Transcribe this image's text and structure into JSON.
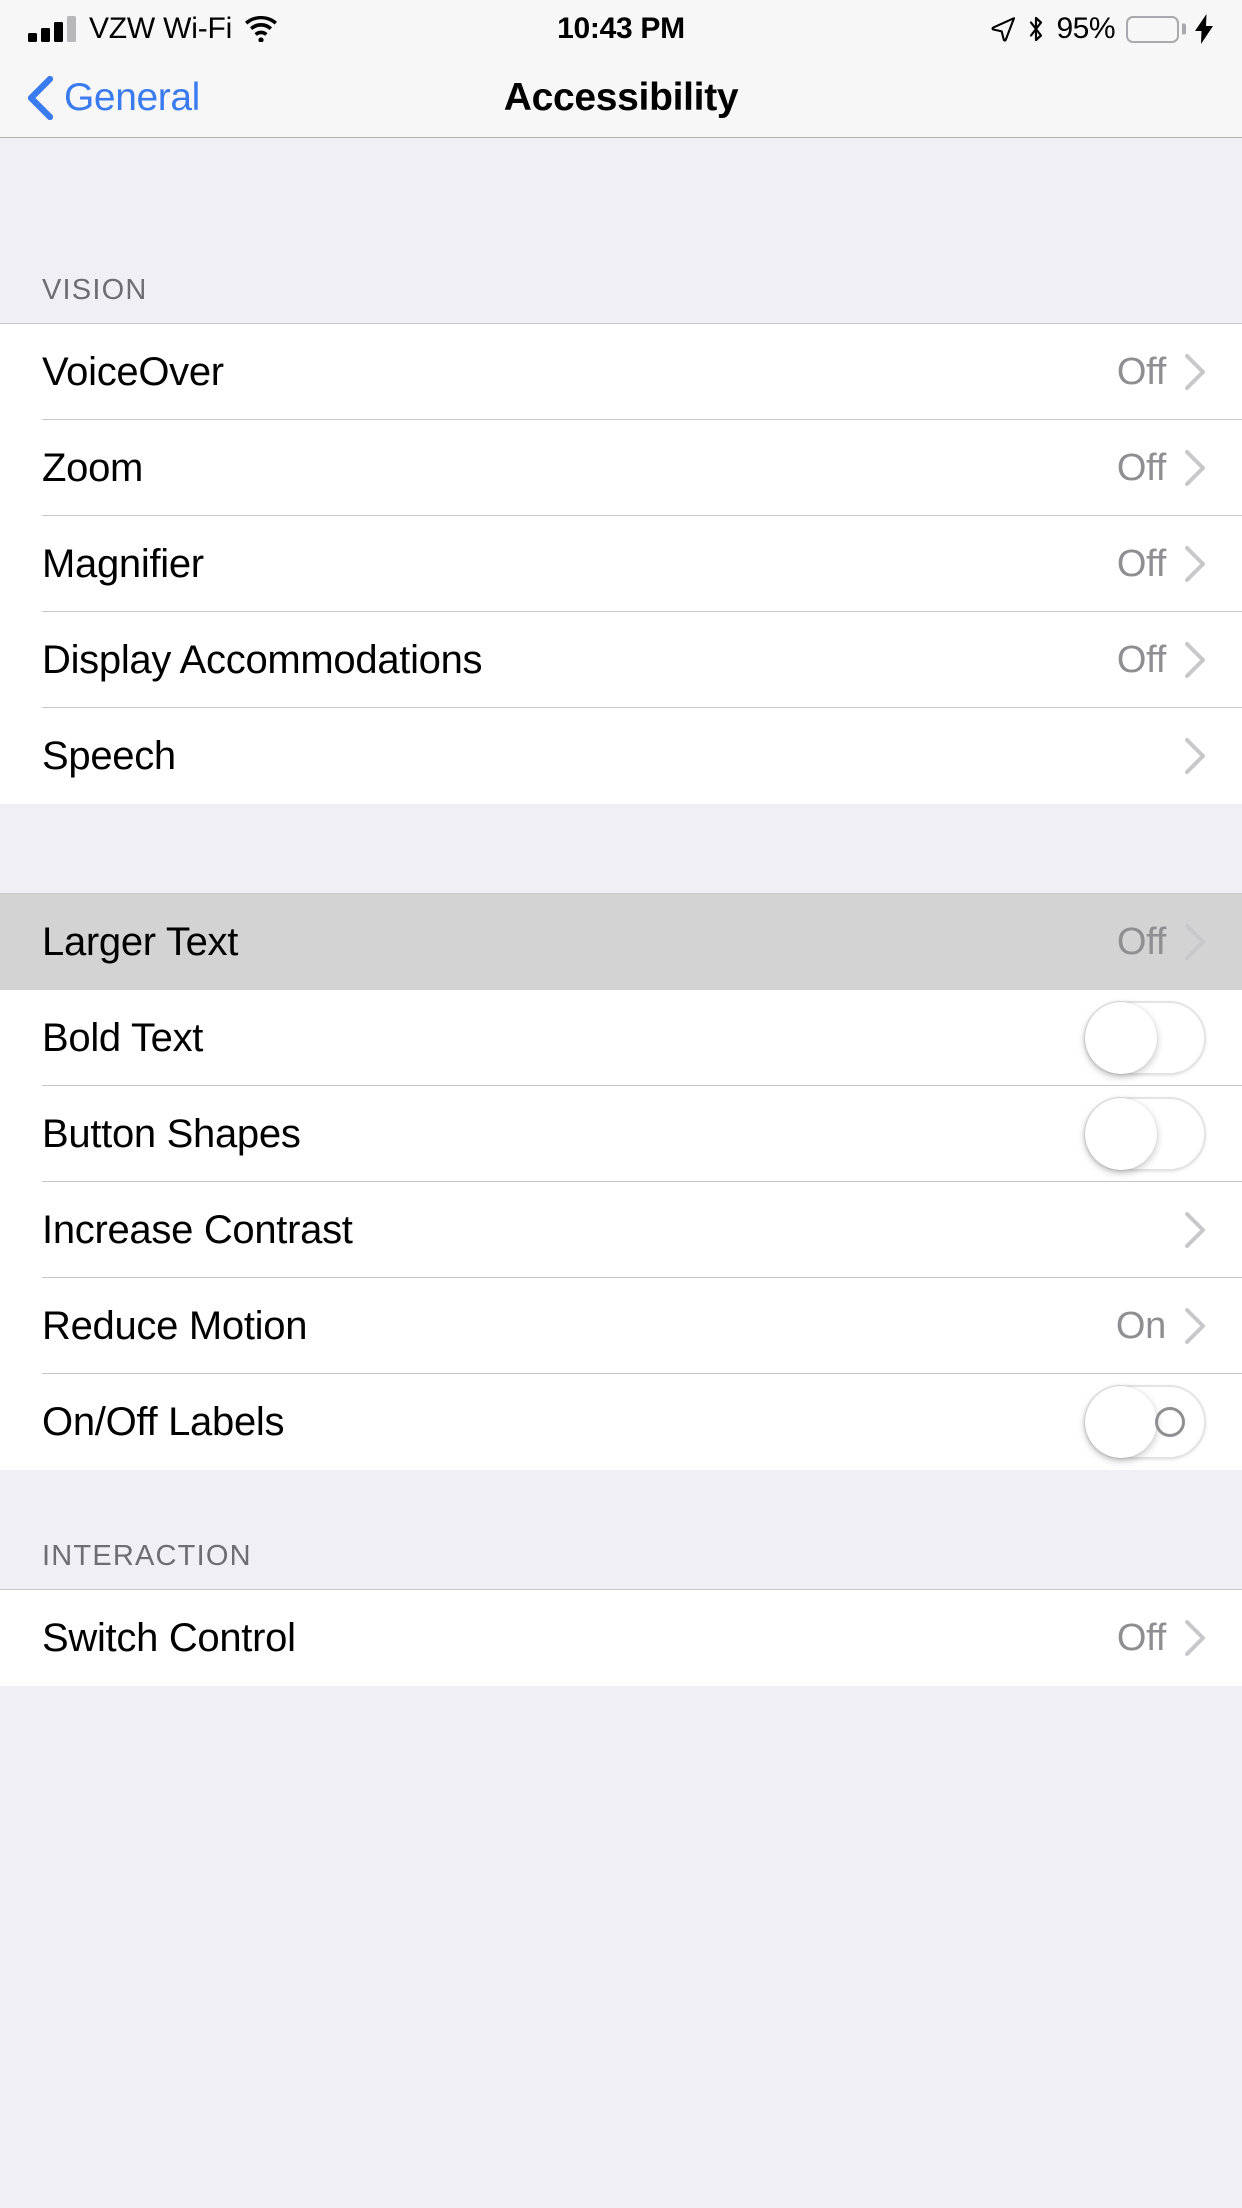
{
  "status_bar": {
    "signal_icon": "cellular-signal-icon",
    "signal_bars_total": 4,
    "signal_bars_filled": 3,
    "carrier": "VZW Wi-Fi",
    "wifi_icon": "wifi-icon",
    "time": "10:43 PM",
    "location_icon": "location-arrow-icon",
    "bluetooth_icon": "bluetooth-icon",
    "battery_percent": "95%",
    "battery_level": 95,
    "battery_icon": "battery-icon",
    "charging_icon": "lightning-bolt-icon",
    "battery_color": "#6BD16B"
  },
  "nav": {
    "back_label": "General",
    "back_icon": "chevron-left-icon",
    "title": "Accessibility",
    "tint_color": "#3A7BEF"
  },
  "sections": [
    {
      "header": "VISION",
      "rows": [
        {
          "label": "VoiceOver",
          "value": "Off",
          "accessory": "chevron",
          "selected": false
        },
        {
          "label": "Zoom",
          "value": "Off",
          "accessory": "chevron",
          "selected": false
        },
        {
          "label": "Magnifier",
          "value": "Off",
          "accessory": "chevron",
          "selected": false
        },
        {
          "label": "Display Accommodations",
          "value": "Off",
          "accessory": "chevron",
          "selected": false
        },
        {
          "label": "Speech",
          "value": "",
          "accessory": "chevron",
          "selected": false
        }
      ]
    },
    {
      "header": "",
      "rows": [
        {
          "label": "Larger Text",
          "value": "Off",
          "accessory": "chevron",
          "selected": true
        },
        {
          "label": "Bold Text",
          "value": "",
          "accessory": "toggle",
          "toggle_on": false,
          "toggle_has_labels": false,
          "selected": false
        },
        {
          "label": "Button Shapes",
          "value": "",
          "accessory": "toggle",
          "toggle_on": false,
          "toggle_has_labels": false,
          "selected": false
        },
        {
          "label": "Increase Contrast",
          "value": "",
          "accessory": "chevron",
          "selected": false
        },
        {
          "label": "Reduce Motion",
          "value": "On",
          "accessory": "chevron",
          "selected": false
        },
        {
          "label": "On/Off Labels",
          "value": "",
          "accessory": "toggle",
          "toggle_on": false,
          "toggle_has_labels": true,
          "selected": false
        }
      ]
    },
    {
      "header": "INTERACTION",
      "rows": [
        {
          "label": "Switch Control",
          "value": "Off",
          "accessory": "chevron",
          "selected": false
        }
      ]
    }
  ]
}
